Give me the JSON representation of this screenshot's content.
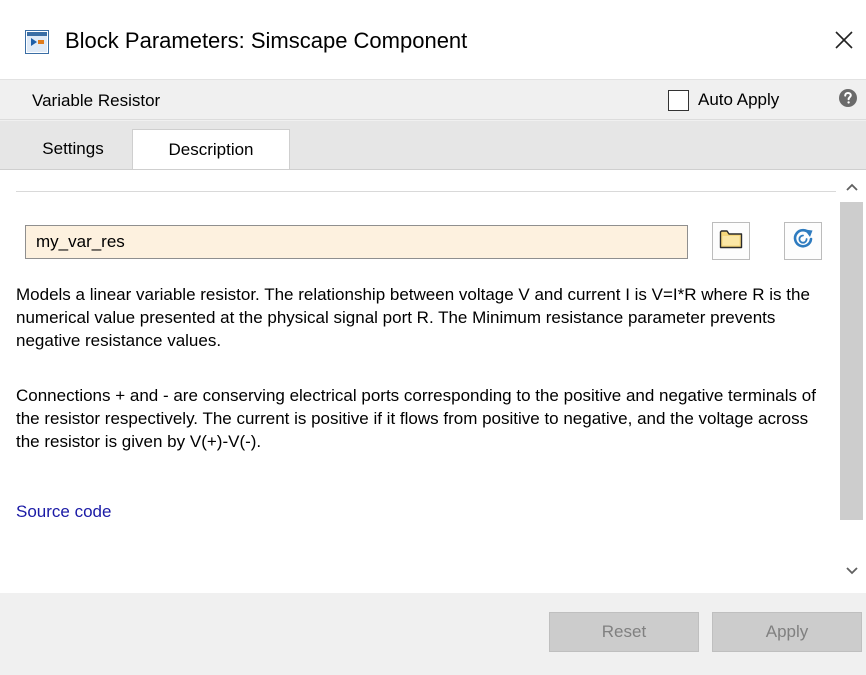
{
  "window": {
    "title": "Block Parameters: Simscape Component"
  },
  "header": {
    "block_name": "Variable Resistor",
    "auto_apply_label": "Auto Apply",
    "auto_apply_checked": false
  },
  "tabs": [
    {
      "label": "Settings",
      "active": false
    },
    {
      "label": "Description",
      "active": true
    }
  ],
  "description": {
    "source_file_value": "my_var_res",
    "paragraph_1": "Models a linear variable resistor. The relationship between voltage V and current I is V=I*R where R is the numerical value presented at the physical signal port R. The Minimum resistance parameter prevents negative resistance values.",
    "paragraph_2": "Connections + and - are conserving electrical ports corresponding to the positive and negative terminals of the resistor respectively. The current is positive if it flows from positive to negative, and the voltage across the resistor is given by V(+)-V(-).",
    "source_link_label": "Source code"
  },
  "footer": {
    "reset_label": "Reset",
    "apply_label": "Apply"
  },
  "icons": {
    "app": "simulink-block-icon",
    "close": "close-icon",
    "help": "help-icon",
    "open_file": "folder-icon",
    "refresh": "refresh-icon"
  },
  "colors": {
    "input_background": "#fdf1df",
    "link": "#1a1aa6",
    "disabled_button": "#cccccc",
    "disabled_text": "#808080"
  }
}
